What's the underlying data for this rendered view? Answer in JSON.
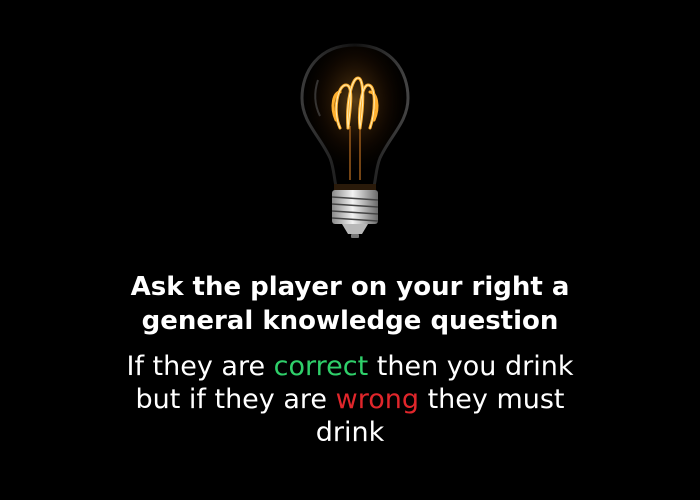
{
  "icon": "light-bulb-icon",
  "colors": {
    "background": "#000000",
    "text": "#ffffff",
    "correct": "#2fcf6a",
    "wrong": "#e0262b",
    "filament": "#ffb030"
  },
  "prompt": {
    "title_line1": "Ask the player on your right a",
    "title_line2": "general knowledge question"
  },
  "rules": {
    "line1_prefix": "If they are ",
    "line1_correct": "correct",
    "line1_suffix": " then you drink",
    "line2_prefix": "but if they are ",
    "line2_wrong": "wrong",
    "line2_suffix": " they must",
    "line3": "drink"
  }
}
